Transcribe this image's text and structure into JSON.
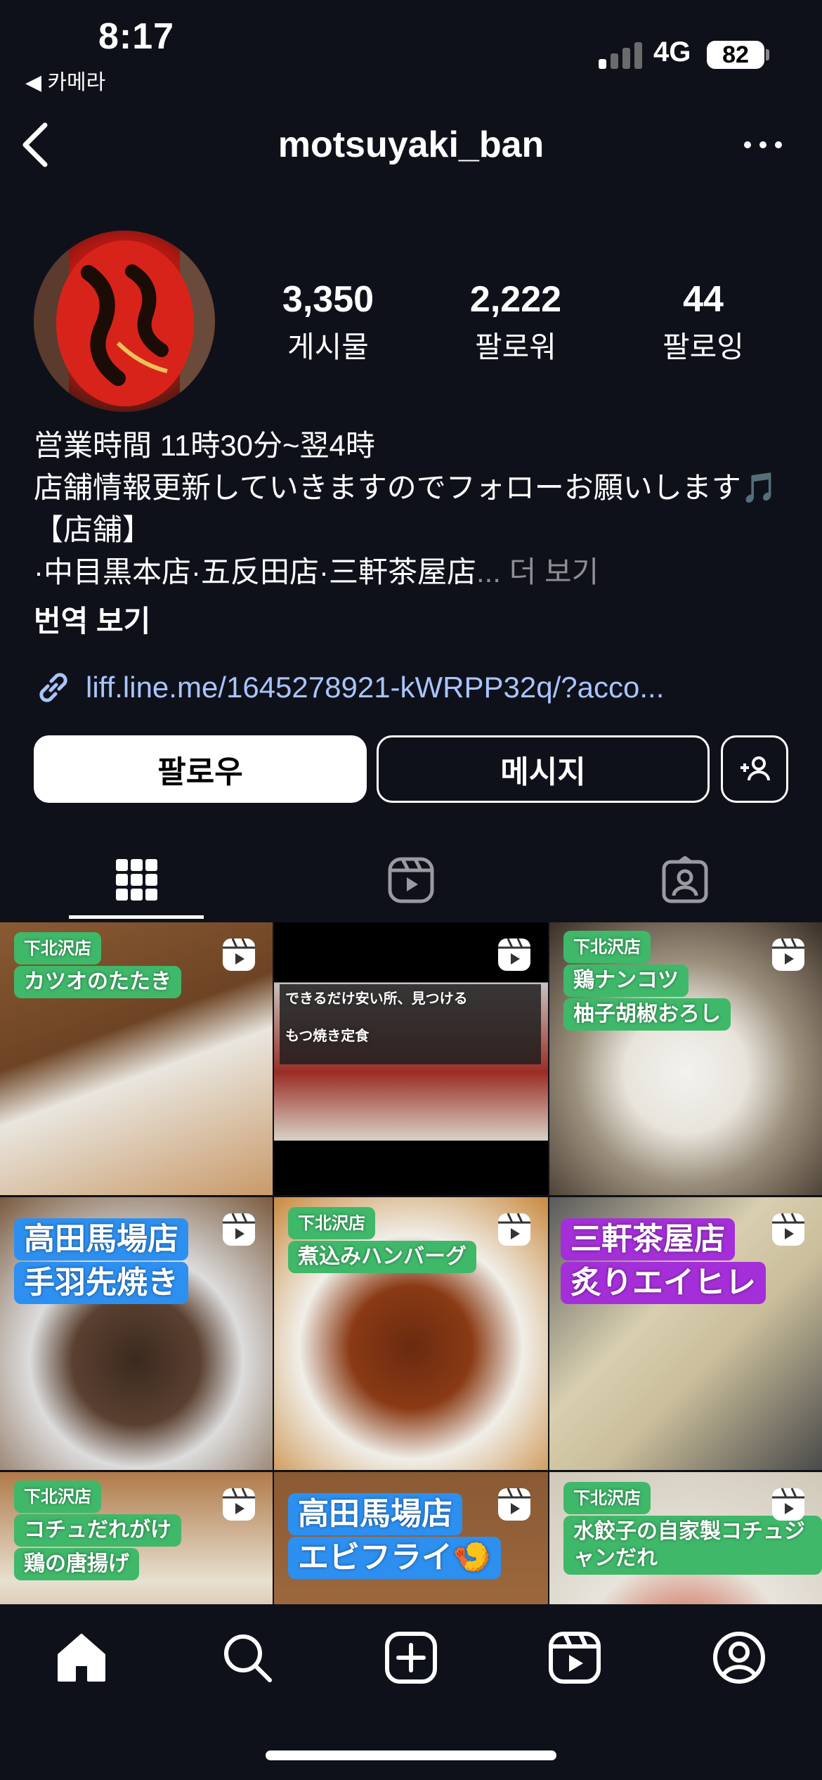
{
  "status_bar": {
    "time": "8:17",
    "back_app": "◀ 카메라",
    "network": "4G",
    "battery": "82"
  },
  "header": {
    "username": "motsuyaki_ban"
  },
  "profile": {
    "stats": [
      {
        "value": "3,350",
        "label": "게시물"
      },
      {
        "value": "2,222",
        "label": "팔로워"
      },
      {
        "value": "44",
        "label": "팔로잉"
      }
    ],
    "bio_lines": [
      "営業時間 11時30分~翌4時",
      "店舗情報更新していきますのでフォローお願いします🎵",
      "【店舗】",
      "·中目黒本店·五反田店·三軒茶屋店"
    ],
    "bio_more": "... 더 보기",
    "translate": "번역 보기",
    "link": "liff.line.me/1645278921-kWRPP32q/?acco..."
  },
  "actions": {
    "follow": "팔로우",
    "message": "메시지"
  },
  "grid": {
    "posts": [
      {
        "caption": [
          "下北沢店",
          "カツオのたたき"
        ],
        "style": "green",
        "reel": true
      },
      {
        "caption": [
          "できるだけ安い所、見つける",
          "もつ焼き定食"
        ],
        "style": "tv",
        "reel": true
      },
      {
        "caption": [
          "下北沢店",
          "鶏ナンコツ",
          "柚子胡椒おろし"
        ],
        "style": "green",
        "reel": true
      },
      {
        "caption": [
          "高田馬場店",
          "手羽先焼き"
        ],
        "style": "blue",
        "reel": true
      },
      {
        "caption": [
          "下北沢店",
          "煮込みハンバーグ"
        ],
        "style": "green",
        "reel": true
      },
      {
        "caption": [
          "三軒茶屋店",
          "炙りエイヒレ"
        ],
        "style": "purple",
        "reel": true
      },
      {
        "caption": [
          "下北沢店",
          "コチュだれがけ",
          "鶏の唐揚げ"
        ],
        "style": "green",
        "reel": true
      },
      {
        "caption": [
          "高田馬場店",
          "エビフライ🍤"
        ],
        "style": "blue",
        "reel": true
      },
      {
        "caption": [
          "下北沢店",
          "水餃子の自家製コチュジャンだれ"
        ],
        "style": "green",
        "reel": true
      }
    ]
  },
  "colors": {
    "background": "#0f111a",
    "link": "#a9c4ff",
    "muted": "#8e8e93"
  }
}
